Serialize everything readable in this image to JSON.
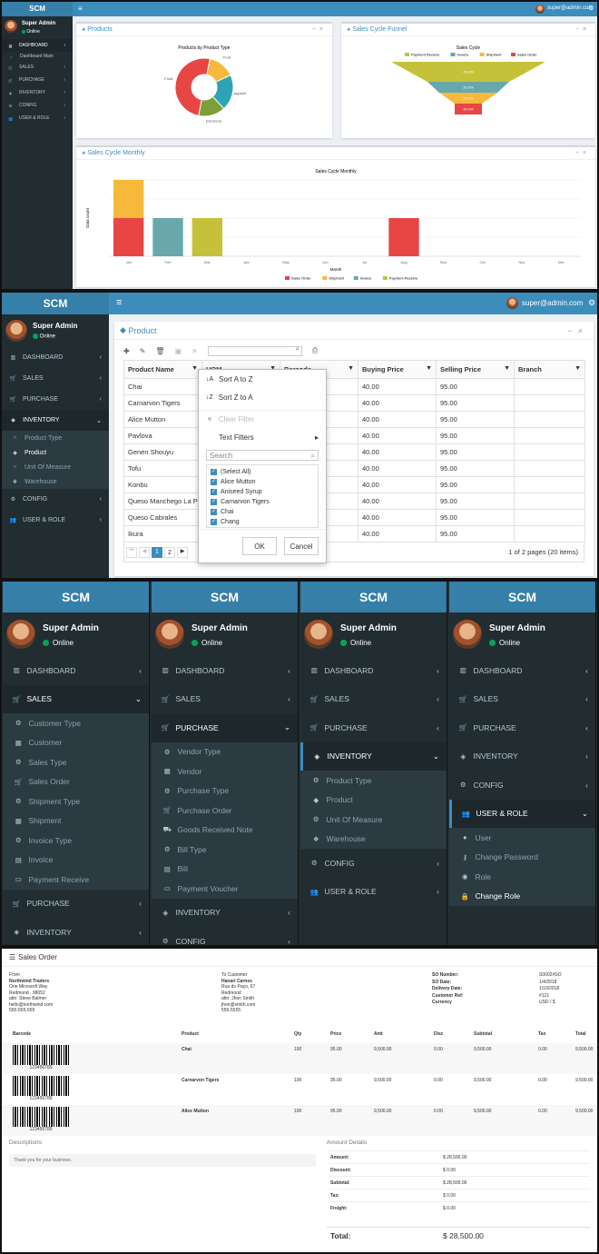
{
  "p1": {
    "brand": "SCM",
    "top_user": "super@admin.com",
    "user": {
      "name": "Super Admin",
      "status": "Online"
    },
    "nav": [
      {
        "label": "DASHBOARD",
        "icon": "bar-chart-icon"
      },
      {
        "label": "Dashboard Main",
        "icon": "circle-icon"
      },
      {
        "label": "SALES",
        "icon": "cart-icon"
      },
      {
        "label": "PURCHASE",
        "icon": "cart-icon"
      },
      {
        "label": "INVENTORY",
        "icon": "cube-icon"
      },
      {
        "label": "CONFIG",
        "icon": "gear-icon"
      },
      {
        "label": "USER & ROLE",
        "icon": "users-icon"
      }
    ],
    "box_products": "Products",
    "box_funnel": "Sales Cycle Funnel",
    "box_monthly": "Sales Cycle Monthly"
  },
  "chart_data": [
    {
      "type": "pie",
      "title": "Products by Product Type",
      "categories": [
        "Fruit",
        "Apparel",
        "Electronic",
        "Food"
      ],
      "values": [
        15,
        20,
        15,
        50
      ],
      "colors": [
        "#f6b93b",
        "#2fa3b6",
        "#7d9f3b",
        "#e84545"
      ]
    },
    {
      "type": "bar",
      "subtype": "funnel",
      "title": "Sales Cycle",
      "categories": [
        "Payment Receive",
        "Invoice",
        "Shipment",
        "Sales Order"
      ],
      "values": [
        40,
        20,
        20,
        20
      ],
      "labels": [
        "40.0%",
        "20.0%",
        "20.0%",
        "20.0%"
      ],
      "colors": [
        "#c5c23a",
        "#68a8ad",
        "#f6b93b",
        "#e84545"
      ],
      "legend": "top"
    },
    {
      "type": "bar",
      "stacked": true,
      "title": "Sales Cycle Monthly",
      "xlabel": "Month",
      "ylabel": "Data count",
      "categories": [
        "Jan",
        "Feb",
        "Mar",
        "Apr",
        "May",
        "Jun",
        "Jul",
        "Aug",
        "Sep",
        "Oct",
        "Nov",
        "Dec"
      ],
      "series": [
        {
          "name": "Sales Order",
          "color": "#e84545",
          "values": [
            1,
            0,
            0,
            0,
            0,
            0,
            0,
            1,
            0,
            0,
            0,
            0
          ]
        },
        {
          "name": "Shipment",
          "color": "#f6b93b",
          "values": [
            1,
            0,
            0,
            0,
            0,
            0,
            0,
            0,
            0,
            0,
            0,
            0
          ]
        },
        {
          "name": "Invoice",
          "color": "#68a8ad",
          "values": [
            0,
            1,
            0,
            0,
            0,
            0,
            0,
            0,
            0,
            0,
            0,
            0
          ]
        },
        {
          "name": "Payment Receive",
          "color": "#c5c23a",
          "values": [
            0,
            0,
            1,
            0,
            0,
            0,
            0,
            0,
            0,
            0,
            0,
            0
          ]
        }
      ],
      "ylim": [
        0,
        2
      ],
      "legend": "bottom"
    }
  ],
  "p2": {
    "brand": "SCM",
    "top_user": "super@admin.com",
    "user": {
      "name": "Super Admin",
      "status": "Online"
    },
    "nav_top": [
      {
        "label": "DASHBOARD",
        "icon": "bar-chart-icon"
      },
      {
        "label": "SALES",
        "icon": "cart-icon"
      },
      {
        "label": "PURCHASE",
        "icon": "cart-icon"
      }
    ],
    "nav_inventory": {
      "label": "INVENTORY",
      "icon": "cube-icon"
    },
    "nav_inventory_sub": [
      {
        "label": "Product Type",
        "icon": "circle-icon"
      },
      {
        "label": "Product",
        "icon": "tag-icon"
      },
      {
        "label": "Unit Of Measure",
        "icon": "circle-icon"
      },
      {
        "label": "Warehouse",
        "icon": "cubes-icon"
      }
    ],
    "nav_bottom": [
      {
        "label": "CONFIG",
        "icon": "gear-icon"
      },
      {
        "label": "USER & ROLE",
        "icon": "users-icon"
      }
    ],
    "title": "Product",
    "columns": [
      "Product Name",
      "UOM",
      "Barcode",
      "Buying Price",
      "Selling Price",
      "Branch"
    ],
    "rows": [
      [
        "Chai",
        "",
        "",
        "40.00",
        "95.00",
        ""
      ],
      [
        "Carnarvon Tigers",
        "",
        "",
        "40.00",
        "95.00",
        ""
      ],
      [
        "Alice Mutton",
        "",
        "",
        "40.00",
        "95.00",
        ""
      ],
      [
        "Pavlova",
        "",
        "",
        "40.00",
        "95.00",
        ""
      ],
      [
        "Genen Shouyu",
        "",
        "",
        "40.00",
        "95.00",
        ""
      ],
      [
        "Tofu",
        "",
        "",
        "40.00",
        "95.00",
        ""
      ],
      [
        "Konbu",
        "",
        "",
        "40.00",
        "95.00",
        ""
      ],
      [
        "Queso Manchego La Pa",
        "",
        "",
        "40.00",
        "95.00",
        ""
      ],
      [
        "Queso Cabrales",
        "",
        "",
        "40.00",
        "95.00",
        ""
      ],
      [
        "Ikura",
        "",
        "",
        "40.00",
        "95.00",
        ""
      ]
    ],
    "pager": {
      "pages": [
        "1",
        "2"
      ],
      "info": "1 of 2 pages (20 items)"
    },
    "filter": {
      "sort_az": "Sort A to Z",
      "sort_za": "Sort Z to A",
      "clear": "Clear Filter",
      "text_filters": "Text Filters",
      "search_placeholder": "Search",
      "items": [
        "(Select All)",
        "Alice Mutton",
        "Aniseed Syrup",
        "Carnarvon Tigers",
        "Chai",
        "Chang"
      ],
      "ok": "OK",
      "cancel": "Cancel"
    }
  },
  "p3": [
    {
      "brand": "SCM",
      "name": "Super Admin",
      "status": "Online",
      "items": [
        {
          "label": "DASHBOARD",
          "icon": "bar-chart-icon",
          "kind": "top"
        },
        {
          "label": "SALES",
          "icon": "cart-icon",
          "kind": "active"
        },
        {
          "label": "Customer Type",
          "icon": "gear-icon",
          "kind": "sub"
        },
        {
          "label": "Customer",
          "icon": "building-icon",
          "kind": "sub"
        },
        {
          "label": "Sales Type",
          "icon": "gear-icon",
          "kind": "sub"
        },
        {
          "label": "Sales Order",
          "icon": "cart-icon",
          "kind": "sub"
        },
        {
          "label": "Shipment Type",
          "icon": "gear-icon",
          "kind": "sub"
        },
        {
          "label": "Shipment",
          "icon": "building-icon",
          "kind": "sub"
        },
        {
          "label": "Invoice Type",
          "icon": "gear-icon",
          "kind": "sub"
        },
        {
          "label": "Invoice",
          "icon": "file-icon",
          "kind": "sub"
        },
        {
          "label": "Payment Receive",
          "icon": "money-icon",
          "kind": "sub"
        },
        {
          "label": "PURCHASE",
          "icon": "cart-icon",
          "kind": "top"
        },
        {
          "label": "INVENTORY",
          "icon": "cube-icon",
          "kind": "top"
        }
      ]
    },
    {
      "brand": "SCM",
      "name": "Super Admin",
      "status": "Online",
      "items": [
        {
          "label": "DASHBOARD",
          "icon": "bar-chart-icon",
          "kind": "top"
        },
        {
          "label": "SALES",
          "icon": "cart-icon",
          "kind": "top"
        },
        {
          "label": "PURCHASE",
          "icon": "cart-icon",
          "kind": "active"
        },
        {
          "label": "Vendor Type",
          "icon": "gear-icon",
          "kind": "sub"
        },
        {
          "label": "Vendor",
          "icon": "building-icon",
          "kind": "sub"
        },
        {
          "label": "Purchase Type",
          "icon": "gear-icon",
          "kind": "sub"
        },
        {
          "label": "Purchase Order",
          "icon": "cart-icon",
          "kind": "sub"
        },
        {
          "label": "Goods Received Note",
          "icon": "truck-icon",
          "kind": "sub"
        },
        {
          "label": "Bill Type",
          "icon": "gear-icon",
          "kind": "sub"
        },
        {
          "label": "Bill",
          "icon": "file-icon",
          "kind": "sub"
        },
        {
          "label": "Payment Voucher",
          "icon": "money-icon",
          "kind": "sub"
        },
        {
          "label": "INVENTORY",
          "icon": "cube-icon",
          "kind": "top"
        },
        {
          "label": "CONFIG",
          "icon": "gear-icon",
          "kind": "top"
        }
      ]
    },
    {
      "brand": "SCM",
      "name": "Super Admin",
      "status": "Online",
      "items": [
        {
          "label": "DASHBOARD",
          "icon": "bar-chart-icon",
          "kind": "top"
        },
        {
          "label": "SALES",
          "icon": "cart-icon",
          "kind": "top"
        },
        {
          "label": "PURCHASE",
          "icon": "cart-icon",
          "kind": "top"
        },
        {
          "label": "INVENTORY",
          "icon": "cube-icon",
          "kind": "active"
        },
        {
          "label": "Product Type",
          "icon": "gear-icon",
          "kind": "sub"
        },
        {
          "label": "Product",
          "icon": "tag-icon",
          "kind": "sub"
        },
        {
          "label": "Unit Of Measure",
          "icon": "gear-icon",
          "kind": "sub"
        },
        {
          "label": "Warehouse",
          "icon": "cubes-icon",
          "kind": "sub"
        },
        {
          "label": "CONFIG",
          "icon": "gear-icon",
          "kind": "top"
        },
        {
          "label": "USER & ROLE",
          "icon": "users-icon",
          "kind": "top"
        }
      ]
    },
    {
      "brand": "SCM",
      "name": "Super Admin",
      "status": "Online",
      "items": [
        {
          "label": "DASHBOARD",
          "icon": "bar-chart-icon",
          "kind": "top"
        },
        {
          "label": "SALES",
          "icon": "cart-icon",
          "kind": "top"
        },
        {
          "label": "PURCHASE",
          "icon": "cart-icon",
          "kind": "top"
        },
        {
          "label": "INVENTORY",
          "icon": "cube-icon",
          "kind": "top"
        },
        {
          "label": "CONFIG",
          "icon": "gear-icon",
          "kind": "top"
        },
        {
          "label": "USER & ROLE",
          "icon": "users-icon",
          "kind": "active"
        },
        {
          "label": "User",
          "icon": "user-icon",
          "kind": "sub"
        },
        {
          "label": "Change Password",
          "icon": "key-icon",
          "kind": "sub"
        },
        {
          "label": "Role",
          "icon": "user-circle-icon",
          "kind": "sub"
        },
        {
          "label": "Change Role",
          "icon": "lock-icon",
          "kind": "sub-cur"
        }
      ]
    }
  ],
  "p4": {
    "title": "Sales Order",
    "from_label": "From",
    "from_lines": [
      "Northwind Traders",
      "One Microsoft Way",
      "Redmond , 98052",
      "attn: Steve Balmer",
      "hello@northwind.com",
      "555-555-555"
    ],
    "to_label": "To Customer",
    "to_lines": [
      "Hanari Carnes",
      "Rua do Paço, 67",
      "Redmond",
      "attn: Jhon Smith",
      "jhon@smith.com",
      "555-5555"
    ],
    "meta": [
      {
        "k": "SO Number:",
        "v": "S0002#SO"
      },
      {
        "k": "SO Date:",
        "v": "1/4/2018"
      },
      {
        "k": "Delivery Date:",
        "v": "1/10/2018"
      },
      {
        "k": "Customer Ref:",
        "v": "#121"
      },
      {
        "k": "Currency",
        "v": "USD / $"
      }
    ],
    "columns": [
      "Barcode",
      "Product",
      "Qty",
      "Price",
      "Amt",
      "Disc",
      "Subtotal",
      "Tax",
      "Total"
    ],
    "rows": [
      {
        "barcode": "123456789",
        "product": "Chai",
        "qty": "100",
        "price": "95.00",
        "amt": "9,500.00",
        "disc": "0.00",
        "subtotal": "9,500.00",
        "tax": "0.00",
        "total": "9,500.00"
      },
      {
        "barcode": "123456789",
        "product": "Carnarvon Tigers",
        "qty": "100",
        "price": "95.00",
        "amt": "9,500.00",
        "disc": "0.00",
        "subtotal": "9,500.00",
        "tax": "0.00",
        "total": "9,500.00"
      },
      {
        "barcode": "123456789",
        "product": "Alice Mutton",
        "qty": "100",
        "price": "95.00",
        "amt": "9,500.00",
        "disc": "0.00",
        "subtotal": "9,500.00",
        "tax": "0.00",
        "total": "9,500.00"
      }
    ],
    "desc_label": "Descriptions:",
    "desc_text": "Thank you for your business.",
    "amount_label": "Amount Details",
    "amounts": [
      {
        "k": "Amount:",
        "v": "$ 28,500.00"
      },
      {
        "k": "Discount:",
        "v": "$ 0.00"
      },
      {
        "k": "Subtotal:",
        "v": "$ 28,500.00"
      },
      {
        "k": "Tax:",
        "v": "$ 0.00"
      },
      {
        "k": "Freight:",
        "v": "$ 0.00"
      }
    ],
    "total_k": "Total:",
    "total_v": "$ 28,500.00"
  }
}
